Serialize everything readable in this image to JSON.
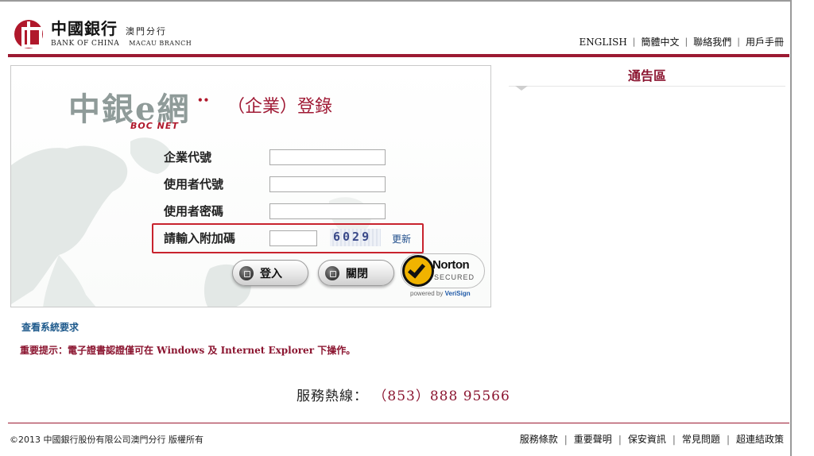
{
  "header": {
    "logo_cn": "中國銀行",
    "logo_cn_branch": "澳門分行",
    "logo_en": "BANK OF CHINA",
    "logo_en_branch": "MACAU BRANCH",
    "nav": [
      {
        "label": "ENGLISH"
      },
      {
        "label": "簡體中文"
      },
      {
        "label": "聯絡我們"
      },
      {
        "label": "用戶手冊"
      }
    ],
    "nav_separator": "|"
  },
  "login": {
    "brand_cn": "中銀e網",
    "brand_arrow": "••",
    "brand_en": "BOC NET",
    "title": "（企業）登錄",
    "fields": [
      {
        "label": "企業代號",
        "value": ""
      },
      {
        "label": "使用者代號",
        "value": ""
      },
      {
        "label": "使用者密碼",
        "value": ""
      }
    ],
    "captcha": {
      "label": "請輸入附加碼",
      "value": "",
      "code": "6029",
      "refresh_label": "更新"
    },
    "login_button": "登入",
    "close_button": "關閉",
    "norton": {
      "brand": "Norton",
      "secured": "SECURED",
      "powered_by": "powered by",
      "powered_brand": "VeriSign"
    }
  },
  "links": {
    "system_requirements": "查看系統要求",
    "important_notice": "重要提示：電子證書認證僅可在 Windows 及 Internet Explorer 下操作。"
  },
  "hotline": {
    "label": "服務熱線：",
    "number": "（853）888 95566"
  },
  "announcement": {
    "title": "通告區"
  },
  "footer": {
    "copyright": "©2013 中國銀行股份有限公司澳門分行 版權所有",
    "nav": [
      {
        "label": "服務條款"
      },
      {
        "label": "重要聲明"
      },
      {
        "label": "保安資訊"
      },
      {
        "label": "常見問題"
      },
      {
        "label": "超連結政策"
      }
    ],
    "nav_separator": "|"
  },
  "colors": {
    "brand_red": "#9c1a32",
    "link_blue": "#1e5a8c",
    "captcha_highlight": "#c8232e"
  }
}
